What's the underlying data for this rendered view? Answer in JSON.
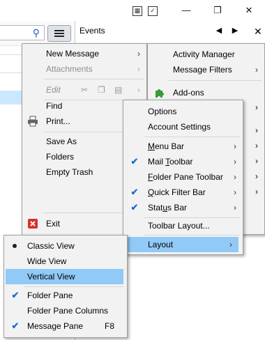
{
  "titlebar": {
    "icons": [
      "calendar-icon",
      "tasks-icon"
    ],
    "controls": {
      "minimize": "—",
      "restore": "❐",
      "close": "✕"
    }
  },
  "events_pane": {
    "title": "Events",
    "prev": "◀",
    "next": "▶"
  },
  "search": {
    "icon": "search-icon",
    "glyph": "⚲"
  },
  "app_menu": {
    "items": [
      {
        "label": "New Message",
        "arrow": "›"
      },
      {
        "label": "Attachments",
        "arrow": "›",
        "disabled": true
      },
      {
        "label": "Edit",
        "arrow": "›",
        "disabled": true
      },
      {
        "label": "Find"
      },
      {
        "label": "Print..."
      },
      {
        "label": "Save As"
      },
      {
        "label": "Folders"
      },
      {
        "label": "Empty Trash"
      },
      {
        "label": "Exit"
      }
    ]
  },
  "right_menu": {
    "items": [
      {
        "label": "Activity Manager"
      },
      {
        "label": "Message Filters",
        "arrow": "›"
      },
      {
        "label": "Add-ons"
      }
    ],
    "arrows": [
      "›",
      "›",
      "›",
      "›",
      "›",
      "›"
    ]
  },
  "options_menu": {
    "items": [
      {
        "label": "Options"
      },
      {
        "label": "Account Settings"
      },
      {
        "label_pre": "",
        "label_u": "M",
        "label_post": "enu Bar",
        "arrow": "›"
      },
      {
        "label_pre": "Mail ",
        "label_u": "T",
        "label_post": "oolbar",
        "arrow": "›",
        "checked": true
      },
      {
        "label_pre": "",
        "label_u": "F",
        "label_post": "older Pane Toolbar",
        "arrow": "›"
      },
      {
        "label_pre": "",
        "label_u": "Q",
        "label_post": "uick Filter Bar",
        "arrow": "›",
        "checked": true
      },
      {
        "label_pre": "Stat",
        "label_u": "u",
        "label_post": "s Bar",
        "arrow": "›",
        "checked": true
      },
      {
        "label": "Toolbar Layout..."
      },
      {
        "label": "Layout",
        "arrow": "›",
        "highlighted": true
      }
    ]
  },
  "layout_menu": {
    "items": [
      {
        "label": "Classic View",
        "selected": true
      },
      {
        "label": "Wide View"
      },
      {
        "label": "Vertical View",
        "highlighted": true
      },
      {
        "label": "Folder Pane",
        "checked": true
      },
      {
        "label": "Folder Pane Columns"
      },
      {
        "label": "Message Pane",
        "shortcut": "F8",
        "checked": true
      }
    ]
  },
  "check_glyph": "✔",
  "colors": {
    "highlight": "#91c9f7",
    "menu_bg": "#f2f2f2",
    "check": "#1f6fd1",
    "selection": "#cce8ff"
  }
}
